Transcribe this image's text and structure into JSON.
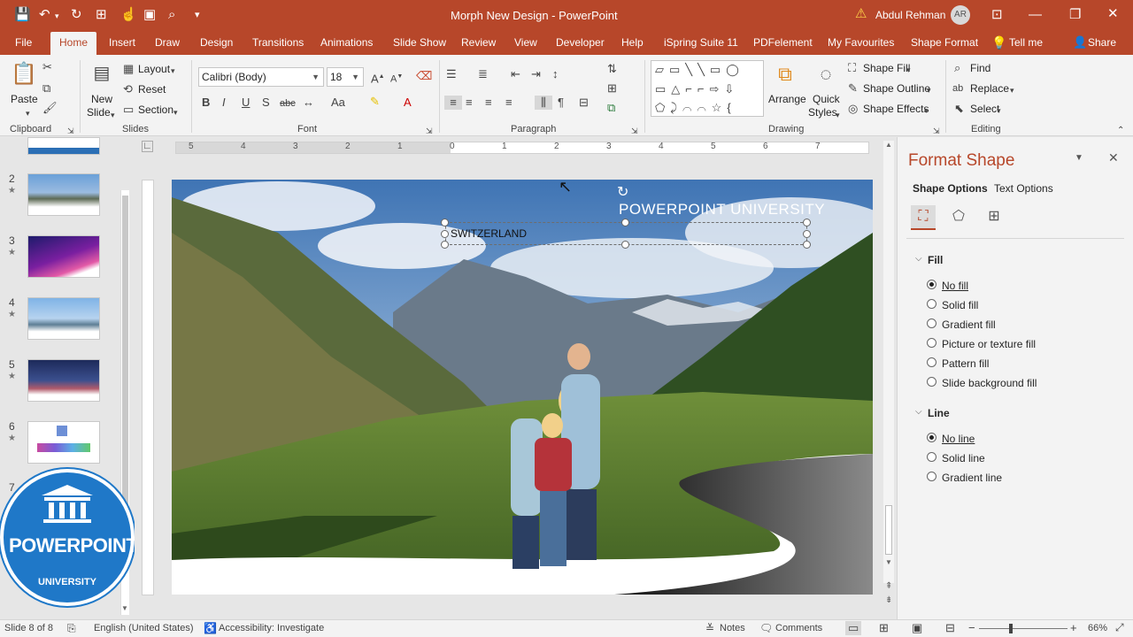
{
  "titlebar": {
    "document_title": "Morph New Design",
    "app_name": "PowerPoint",
    "separator": " - ",
    "user_name": "Abdul Rehman",
    "user_initials": "AR"
  },
  "tabs": [
    "File",
    "Home",
    "Insert",
    "Draw",
    "Design",
    "Transitions",
    "Animations",
    "Slide Show",
    "Review",
    "View",
    "Developer",
    "Help",
    "iSpring Suite 11",
    "PDFelement",
    "My Favourites",
    "Shape Format"
  ],
  "tell_me": "Tell me",
  "share": "Share",
  "ribbon": {
    "clipboard": {
      "label": "Clipboard",
      "paste": "Paste"
    },
    "slides": {
      "label": "Slides",
      "new_slide_1": "New",
      "new_slide_2": "Slide",
      "layout": "Layout",
      "reset": "Reset",
      "section": "Section"
    },
    "font": {
      "label": "Font",
      "font_name": "Calibri (Body)",
      "font_size": "18"
    },
    "paragraph": {
      "label": "Paragraph"
    },
    "drawing": {
      "label": "Drawing",
      "arrange": "Arrange",
      "quick_styles_1": "Quick",
      "quick_styles_2": "Styles",
      "shape_fill": "Shape Fill",
      "shape_outline": "Shape Outline",
      "shape_effects": "Shape Effects"
    },
    "editing": {
      "label": "Editing",
      "find": "Find",
      "replace": "Replace",
      "select": "Select"
    }
  },
  "thumbnails": [
    {
      "num": "2",
      "star": "★"
    },
    {
      "num": "3",
      "star": "★"
    },
    {
      "num": "4",
      "star": "★"
    },
    {
      "num": "5",
      "star": "★"
    },
    {
      "num": "6",
      "star": "★"
    },
    {
      "num": "7",
      "star": ""
    }
  ],
  "ruler_numbers": [
    "5",
    "4",
    "3",
    "2",
    "1",
    "0",
    "1",
    "2",
    "3",
    "4",
    "5",
    "6",
    "7"
  ],
  "slide": {
    "heading": "POWERPOINT UNIVERSITY",
    "selected_text": "SWITZERLAND"
  },
  "logo": {
    "word1": "POWERPOINT",
    "word2": "UNIVERSITY"
  },
  "format_pane": {
    "title": "Format Shape",
    "tab_shape": "Shape Options",
    "tab_text": "Text Options",
    "fill_header": "Fill",
    "fill_options": [
      "No fill",
      "Solid fill",
      "Gradient fill",
      "Picture or texture fill",
      "Pattern fill",
      "Slide background fill"
    ],
    "fill_selected": 0,
    "line_header": "Line",
    "line_options": [
      "No line",
      "Solid line",
      "Gradient line"
    ],
    "line_selected": 0
  },
  "status": {
    "slide_info": "Slide 8 of 8",
    "language": "English (United States)",
    "accessibility": "Accessibility: Investigate",
    "notes": "Notes",
    "comments": "Comments",
    "zoom": "66%"
  },
  "colors": {
    "accent": "#b7472a",
    "logo_blue": "#1f78c8"
  }
}
